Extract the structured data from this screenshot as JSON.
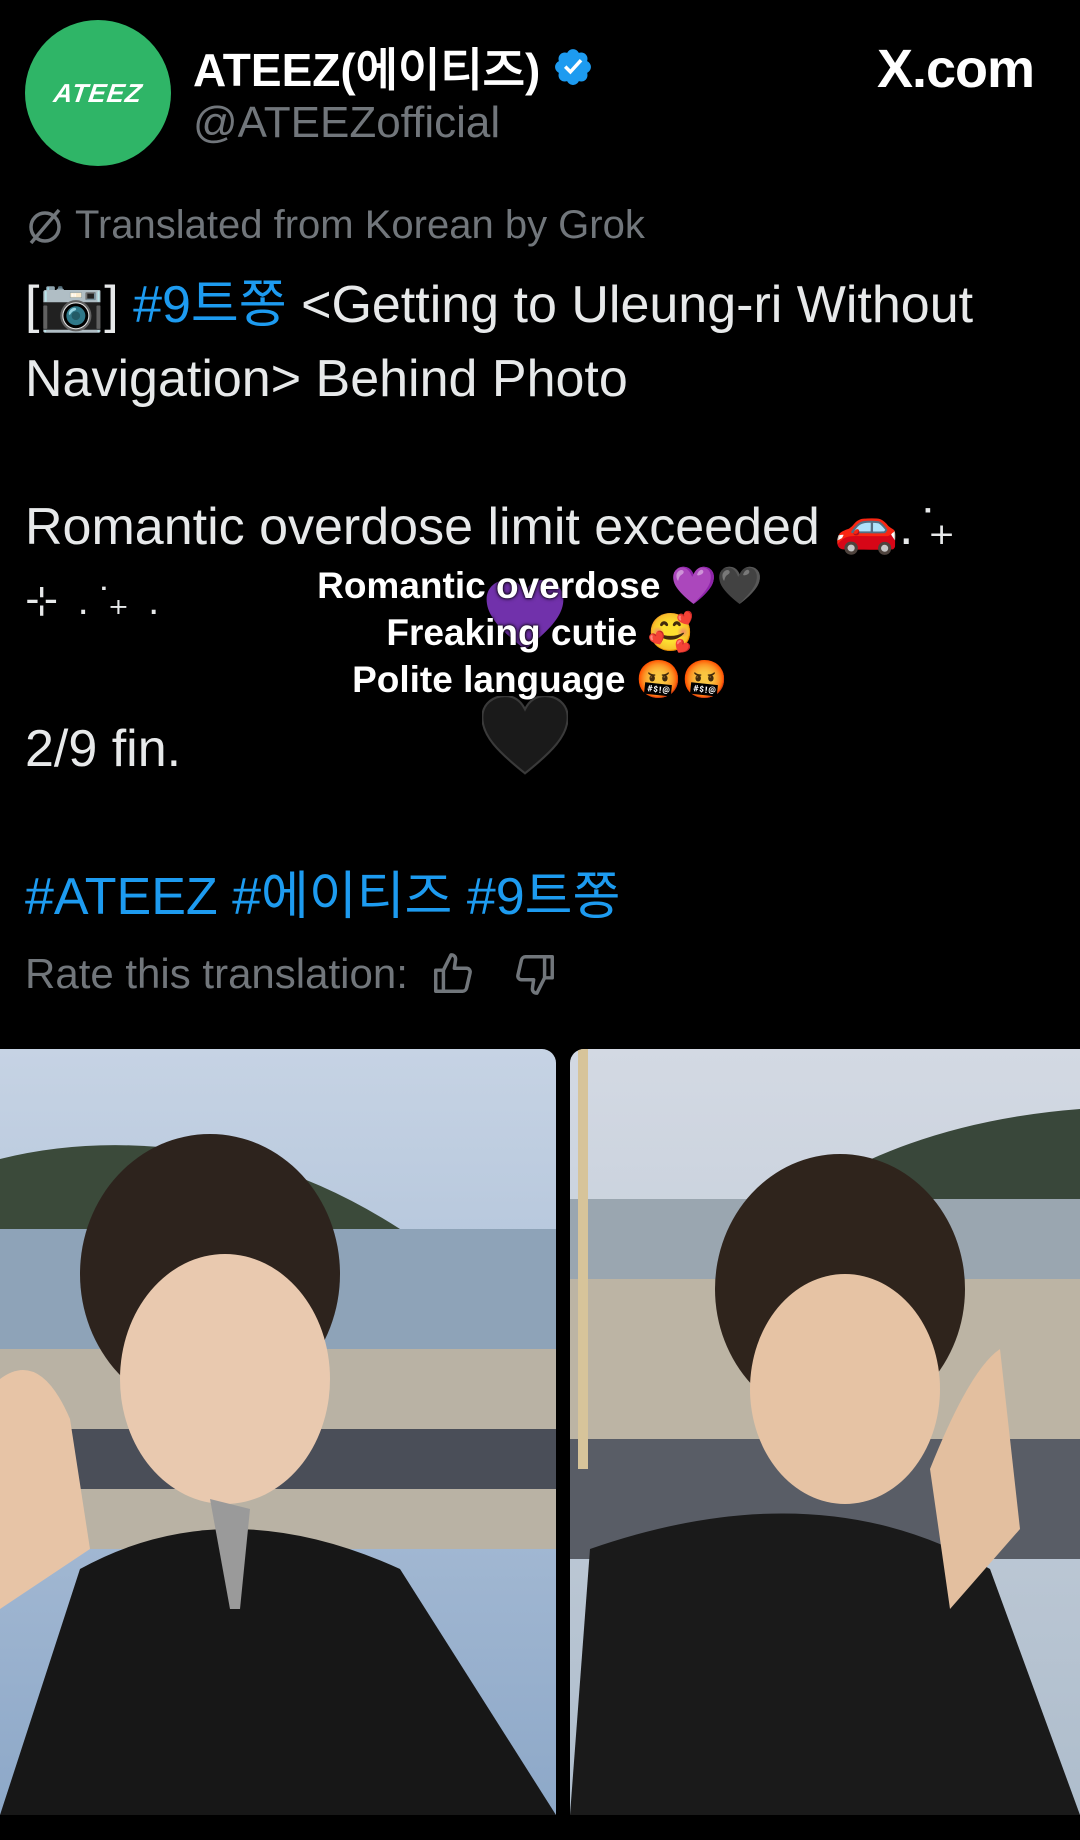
{
  "account": {
    "avatar_text": "ATEEZ",
    "display_name": "ATEEZ(에이티즈)",
    "handle": "@ATEEZofficial",
    "verified": true
  },
  "site_label": "X.com",
  "translation_note": "Translated from Korean by Grok",
  "tweet": {
    "line1_prefix": "[📷] ",
    "line1_hashtag": "#9트쫑",
    "line1_rest": " <Getting to Uleung-ri Without",
    "line2": "Navigation> Behind Photo",
    "line3": "Romantic overdose limit exceeded 🚗. ̇₊",
    "line4": "⊹ . ̇₊ .",
    "line5": "2/9 fin.",
    "hashtags": "#ATEEZ #에이티즈 #9트쫑"
  },
  "rate_label": "Rate this translation:",
  "overlay": {
    "line1": "Romantic overdose 💜🖤",
    "line2": "Freaking cutie 🥰",
    "line3": "Polite language 🤬🤬"
  },
  "colors": {
    "background": "#000000",
    "link": "#1d9bf0",
    "muted": "#71767b",
    "avatar": "#2fb567",
    "verified": "#1d9bf0"
  },
  "icons": [
    "verified-badge-icon",
    "grok-icon",
    "thumbs-up-icon",
    "thumbs-down-icon",
    "black-heart-icon",
    "purple-heart-icon"
  ]
}
